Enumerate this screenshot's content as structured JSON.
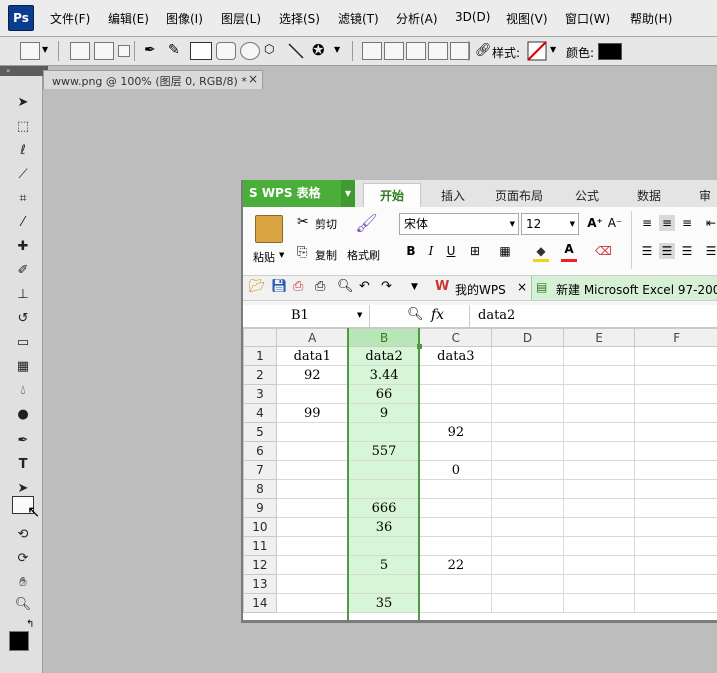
{
  "app": {
    "logo_text": "Ps"
  },
  "menubar": {
    "items": [
      "文件(F)",
      "编辑(E)",
      "图像(I)",
      "图层(L)",
      "选择(S)",
      "滤镜(T)",
      "分析(A)",
      "3D(D)",
      "视图(V)",
      "窗口(W)",
      "帮助(H)"
    ]
  },
  "options_bar": {
    "style_label": "样式:",
    "color_label": "颜色:"
  },
  "doc_tab": {
    "title": "www.png @ 100% (图层 0, RGB/8) *",
    "close": "×"
  },
  "wps": {
    "brand": "S WPS 表格",
    "tabs": [
      "开始",
      "插入",
      "页面布局",
      "公式",
      "数据",
      "审阅"
    ],
    "active_tab": "开始",
    "ribbon": {
      "paste": "粘贴",
      "cut": "剪切",
      "copy": "复制",
      "format_painter": "格式刷",
      "font_name": "宋体",
      "font_size": "12"
    },
    "quickbar": {
      "my_wps": "我的WPS",
      "close": "×",
      "doc_tab": "新建 Microsoft Excel 97-200"
    },
    "formula": {
      "cell_ref": "B1",
      "fx": "fx",
      "value": "data2"
    },
    "sheet": {
      "columns": [
        "A",
        "B",
        "C",
        "D",
        "E",
        "F"
      ],
      "rows": [
        [
          "1",
          "data1",
          "data2",
          "data3"
        ],
        [
          "2",
          "92",
          "3.44",
          ""
        ],
        [
          "3",
          "",
          "66",
          ""
        ],
        [
          "4",
          "99",
          "9",
          ""
        ],
        [
          "5",
          "",
          "",
          "92"
        ],
        [
          "6",
          "",
          "557",
          ""
        ],
        [
          "7",
          "",
          "",
          "0"
        ],
        [
          "8",
          "",
          "",
          ""
        ],
        [
          "9",
          "",
          "666",
          ""
        ],
        [
          "10",
          "",
          "36",
          ""
        ],
        [
          "11",
          "",
          "",
          ""
        ],
        [
          "12",
          "",
          "5",
          "22"
        ],
        [
          "13",
          "",
          "",
          ""
        ],
        [
          "14",
          "",
          "35",
          ""
        ]
      ]
    }
  },
  "colors": {
    "wps_green": "#4cae3a",
    "selection_green": "#d7f5d7"
  }
}
